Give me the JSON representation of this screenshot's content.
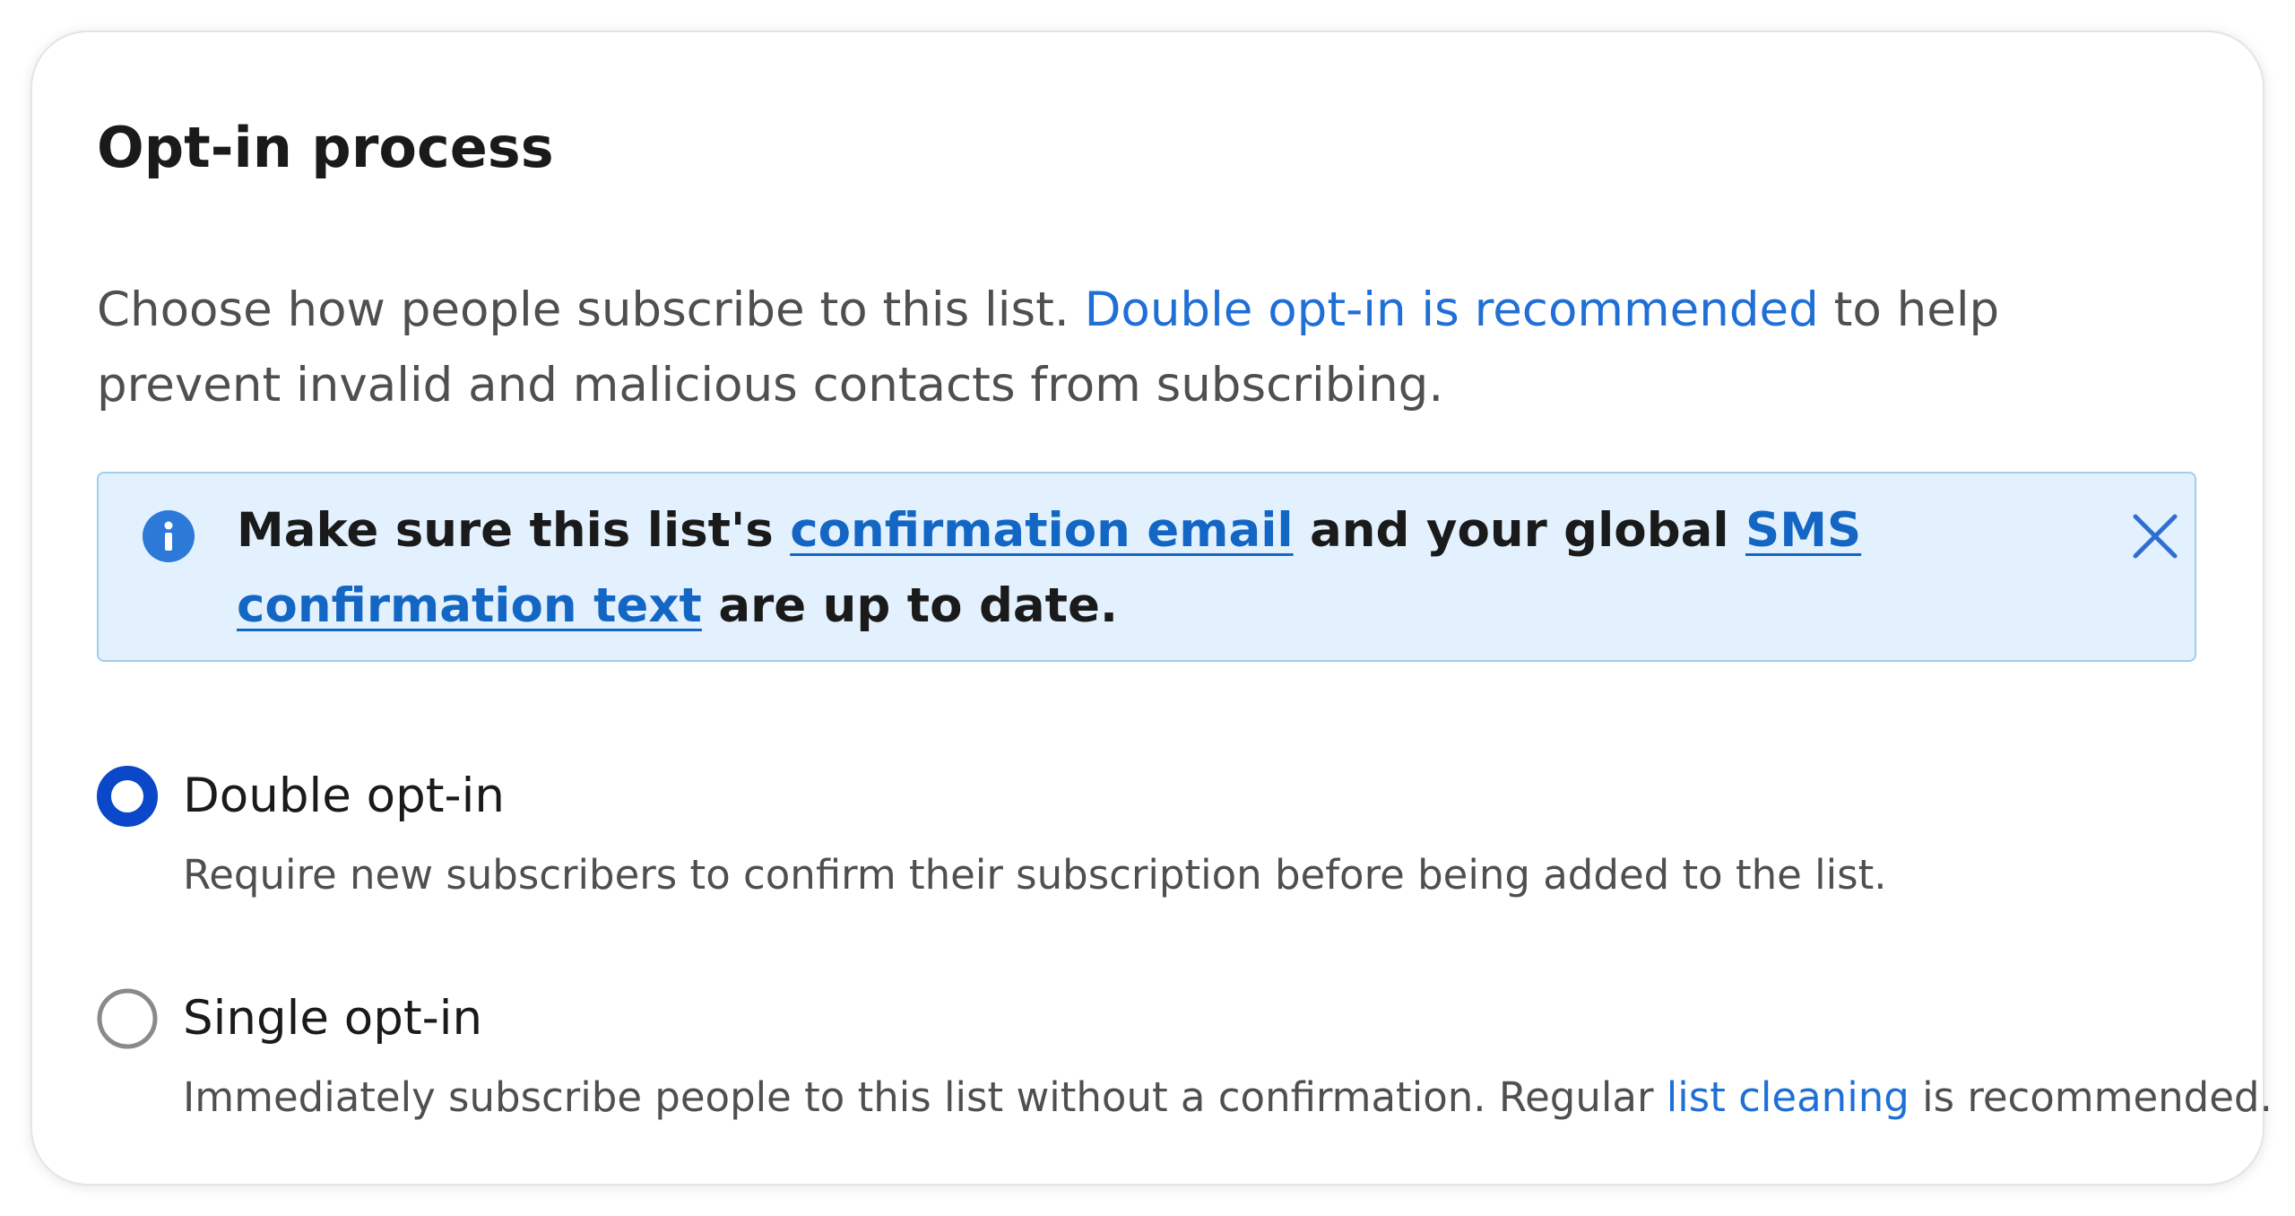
{
  "section": {
    "title": "Opt-in process",
    "intro_before": "Choose how people subscribe to this list. ",
    "intro_link": "Double opt-in is recommended",
    "intro_after": " to help prevent invalid and malicious contacts from subscribing."
  },
  "notice": {
    "icon": "info-icon",
    "text_1": "Make sure this list's ",
    "link_1": "confirmation email",
    "text_2": " and your global ",
    "link_2": "SMS confirmation text",
    "text_3": " are up to date.",
    "close_icon": "close-icon",
    "background_color": "#e2f1fd",
    "border_color": "#9fcdee"
  },
  "options": [
    {
      "label": "Double opt-in",
      "description": "Require new subscribers to confirm their subscription before being added to the list.",
      "selected": true
    },
    {
      "label": "Single opt-in",
      "description_before": "Immediately subscribe people to this list without a confirmation. Regular ",
      "description_link": "list cleaning",
      "description_after": " is recommended.",
      "selected": false
    }
  ],
  "colors": {
    "accent": "#0a47c9",
    "link": "#1f6fd6",
    "radio_unselected": "#8a8a8a"
  }
}
